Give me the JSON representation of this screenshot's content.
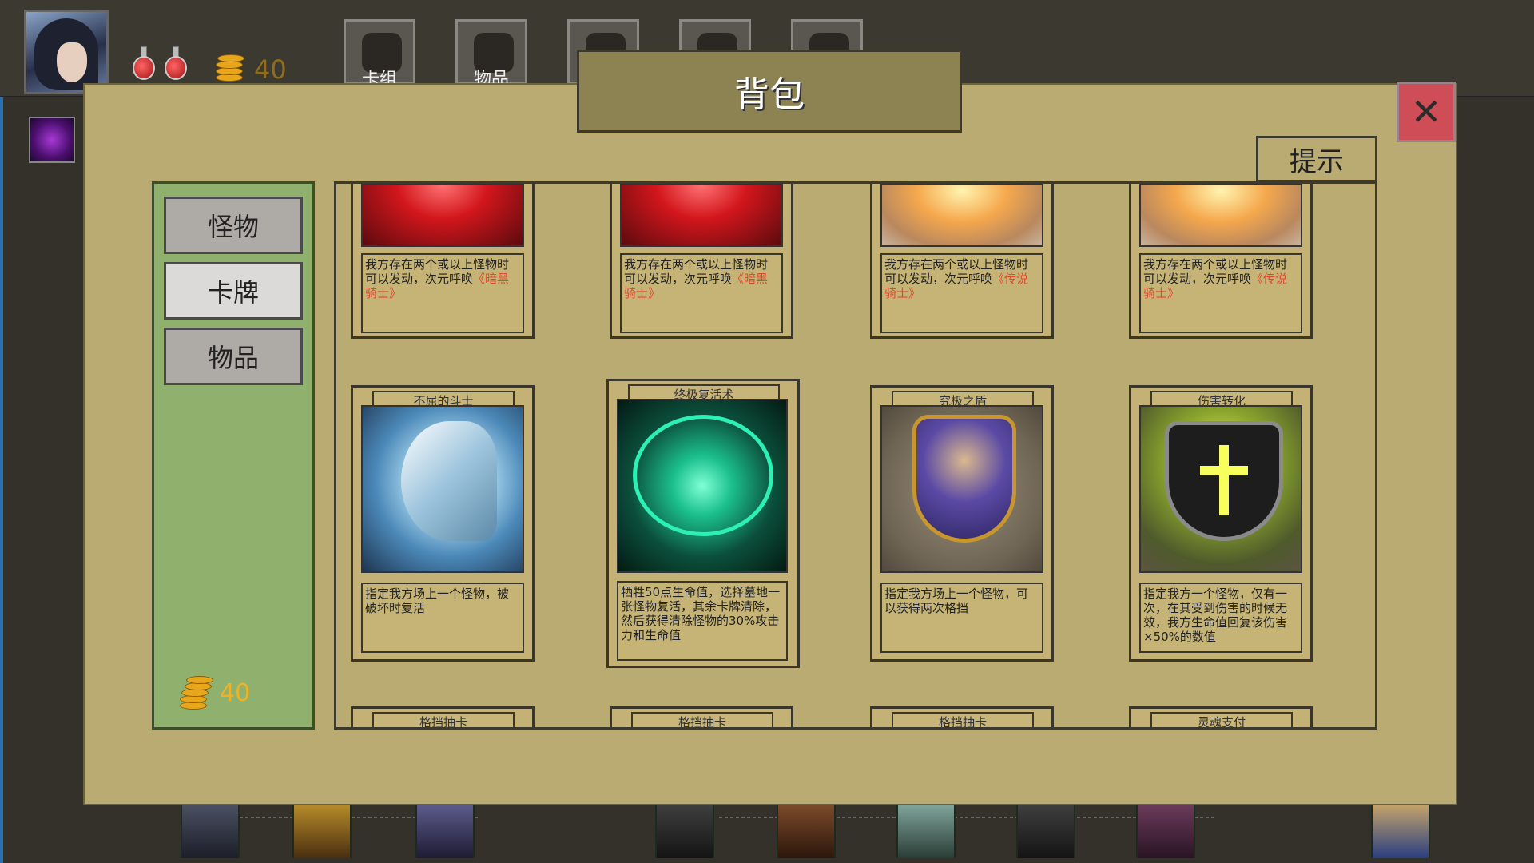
{
  "hud": {
    "gold": "40",
    "tabs": [
      {
        "label": "卡组",
        "icon": "bag-icon"
      },
      {
        "label": "物品",
        "icon": "sack-icon"
      },
      {
        "label": "",
        "icon": "cat-icon"
      },
      {
        "label": "",
        "icon": "gear-icon"
      },
      {
        "label": "",
        "icon": "book-icon"
      }
    ]
  },
  "dialog": {
    "title": "背包",
    "close_label": "✕",
    "hint_label": "提示"
  },
  "sidebar": {
    "categories": [
      {
        "label": "怪物",
        "state": "inactive"
      },
      {
        "label": "卡牌",
        "state": "active"
      },
      {
        "label": "物品",
        "state": "inactive"
      }
    ],
    "gold": "40"
  },
  "cards_row1": [
    {
      "desc": "我方存在两个或以上怪物时可以发动，次元呼唤",
      "highlight": "《暗黑骑士",
      "tail": "》"
    },
    {
      "desc": "我方存在两个或以上怪物时可以发动，次元呼唤",
      "highlight": "《暗黑骑士",
      "tail": "》"
    },
    {
      "desc": "我方存在两个或以上怪物时可以发动，次元呼唤",
      "highlight": "《传说骑士",
      "tail": "》"
    },
    {
      "desc": "我方存在两个或以上怪物时可以发动，次元呼唤",
      "highlight": "《传说骑士",
      "tail": "》"
    }
  ],
  "cards_row2": [
    {
      "name": "不屈的斗士",
      "desc": "指定我方场上一个怪物，被破坏时复活"
    },
    {
      "name": "终极复活术",
      "desc": "牺牲50点生命值，选择墓地一张怪物复活，其余卡牌清除，然后获得清除怪物的30%攻击力和生命值"
    },
    {
      "name": "究极之盾",
      "desc": "指定我方场上一个怪物，可以获得两次格挡"
    },
    {
      "name": "伤害转化",
      "desc": "指定我方一个怪物，仅有一次，在其受到伤害的时候无效，我方生命值回复该伤害×50%的数值"
    }
  ],
  "cards_row3": [
    {
      "name": "格挡抽卡"
    },
    {
      "name": "格挡抽卡"
    },
    {
      "name": "格挡抽卡"
    },
    {
      "name": "灵魂支付"
    }
  ],
  "colors": {
    "dialog_bg": "#b9ab72",
    "sidebar_bg": "#8fb16d",
    "close_bg": "#cf4d57",
    "highlight": "#e0482f",
    "gold": "#f1b124"
  }
}
